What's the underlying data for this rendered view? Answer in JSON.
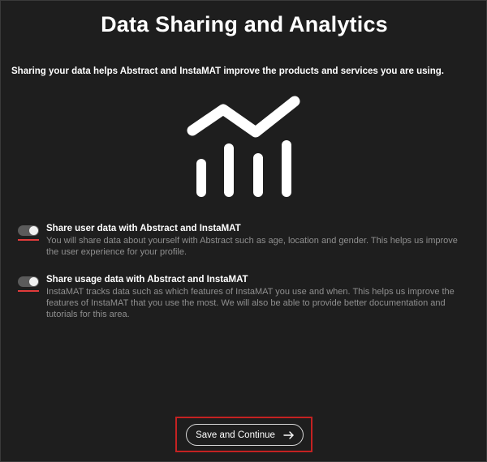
{
  "page": {
    "title": "Data Sharing and Analytics",
    "subtitle": "Sharing your data helps Abstract and InstaMAT improve the products and services you are using."
  },
  "graphic": {
    "icon": "analytics-chart-icon"
  },
  "options": [
    {
      "title": "Share user data with Abstract and InstaMAT",
      "description": "You will share data about yourself with Abstract such as age, location and gender. This helps us improve the user experience for your profile.",
      "enabled": true
    },
    {
      "title": "Share usage data with Abstract and InstaMAT",
      "description": "InstaMAT tracks data such as which features of InstaMAT you use and when. This helps us improve the features of InstaMAT that you use the most. We will also be able to provide better documentation and tutorials for this area.",
      "enabled": true
    }
  ],
  "actions": {
    "continue_label": "Save and Continue",
    "continue_icon": "arrow-right-icon"
  },
  "colors": {
    "background": "#1e1e1e",
    "accent_red": "#e03b3b",
    "focus_frame": "#c42222",
    "description_text": "#8f8f8f"
  }
}
